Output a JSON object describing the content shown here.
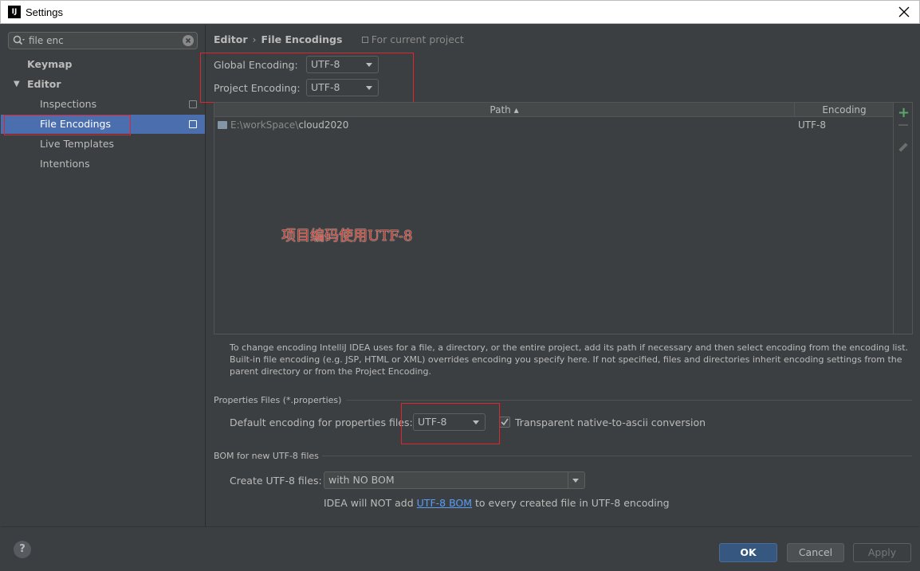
{
  "window": {
    "title": "Settings",
    "app_icon_text": "IJ"
  },
  "sidebar": {
    "search_value": "file enc",
    "items": [
      {
        "label": "Keymap"
      },
      {
        "label": "Editor"
      },
      {
        "label": "Inspections"
      },
      {
        "label": "File Encodings"
      },
      {
        "label": "Live Templates"
      },
      {
        "label": "Intentions"
      }
    ]
  },
  "breadcrumb": {
    "parent": "Editor",
    "separator": "›",
    "current": "File Encodings",
    "scope": "For current project"
  },
  "global_encoding": {
    "label": "Global Encoding:",
    "value": "UTF-8"
  },
  "project_encoding": {
    "label": "Project Encoding:",
    "value": "UTF-8"
  },
  "table": {
    "headers": {
      "path": "Path ▴",
      "encoding": "Encoding"
    },
    "rows": [
      {
        "path_prefix": "E:\\workSpace\\",
        "path_name": "cloud2020",
        "encoding": "UTF-8"
      }
    ],
    "annotation": "项目编码使用UTF-8"
  },
  "help_text": "To change encoding IntelliJ IDEA uses for a file, a directory, or the entire project, add its path if necessary and then select encoding from the encoding list. Built-in file encoding (e.g. JSP, HTML or XML) overrides encoding you specify here. If not specified, files and directories inherit encoding settings from the parent directory or from the Project Encoding.",
  "properties": {
    "section_title": "Properties Files (*.properties)",
    "default_label": "Default encoding for properties files:",
    "default_value": "UTF-8",
    "transparent_label": "Transparent native-to-ascii conversion",
    "transparent_checked": true
  },
  "bom": {
    "section_title": "BOM for new UTF-8 files",
    "create_label": "Create UTF-8 files:",
    "create_value": "with NO BOM",
    "note_prefix": "IDEA will NOT add ",
    "note_link": "UTF-8 BOM",
    "note_suffix": " to every created file in UTF-8 encoding"
  },
  "buttons": {
    "ok": "OK",
    "cancel": "Cancel",
    "apply": "Apply",
    "help": "?"
  },
  "colors": {
    "accent": "#4b6eaf",
    "background": "#3c3f41",
    "highlight": "#e0262d",
    "add": "#59a869"
  },
  "icons": [
    "search-icon",
    "clear-icon",
    "close-icon",
    "copy-icon",
    "folder-icon",
    "add-icon",
    "remove-icon",
    "edit-icon",
    "checkmark-icon",
    "help-icon"
  ]
}
